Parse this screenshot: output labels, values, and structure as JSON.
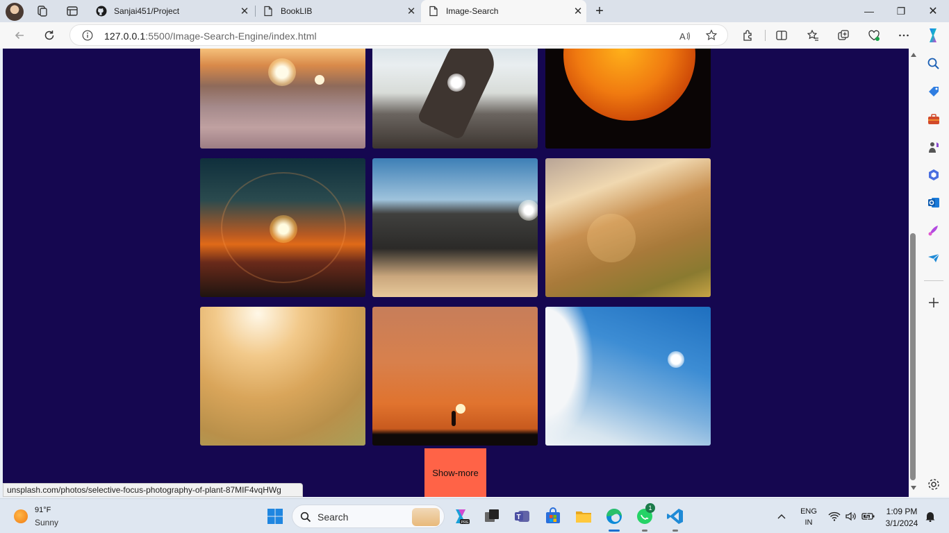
{
  "browser": {
    "tabs": [
      {
        "title": "Sanjai451/Project",
        "active": false
      },
      {
        "title": "BookLIB",
        "active": false
      },
      {
        "title": "Image-Search",
        "active": true
      }
    ],
    "url_host": "127.0.0.1",
    "url_rest": ":5500/Image-Search-Engine/index.html",
    "icons": [
      "back-icon",
      "refresh-icon",
      "info-icon",
      "read-aloud-icon",
      "favorite-star-icon",
      "extensions-icon",
      "split-screen-icon",
      "favorites-icon",
      "collections-icon",
      "browser-essentials-icon",
      "more-icon",
      "copilot-icon"
    ]
  },
  "page": {
    "show_more_label": "Show-more",
    "status_url": "unsplash.com/photos/selective-focus-photography-of-plant-87MIF4vqHWg",
    "background_color": "#150750",
    "button_color": "#ff6347",
    "images": [
      {
        "name": "sunset-over-clouds"
      },
      {
        "name": "hand-holding-sun"
      },
      {
        "name": "sun-surface"
      },
      {
        "name": "sunrise-lens-flare"
      },
      {
        "name": "desert-dunes-mountains"
      },
      {
        "name": "sunlit-grass-hill"
      },
      {
        "name": "golden-grass-bokeh"
      },
      {
        "name": "silhouette-holding-sun"
      },
      {
        "name": "blue-sky-clouds-sun"
      }
    ]
  },
  "sidebar": {
    "icons": [
      "search-icon",
      "shopping-icon",
      "tools-icon",
      "games-icon",
      "microsoft-365-icon",
      "outlook-icon",
      "designer-icon",
      "drop-icon",
      "add-icon",
      "settings-icon"
    ]
  },
  "taskbar": {
    "weather_temp": "91°F",
    "weather_cond": "Sunny",
    "search_placeholder": "Search",
    "language_top": "ENG",
    "language_bottom": "IN",
    "time": "1:09 PM",
    "date": "3/1/2024",
    "whatsapp_badge": "1"
  }
}
